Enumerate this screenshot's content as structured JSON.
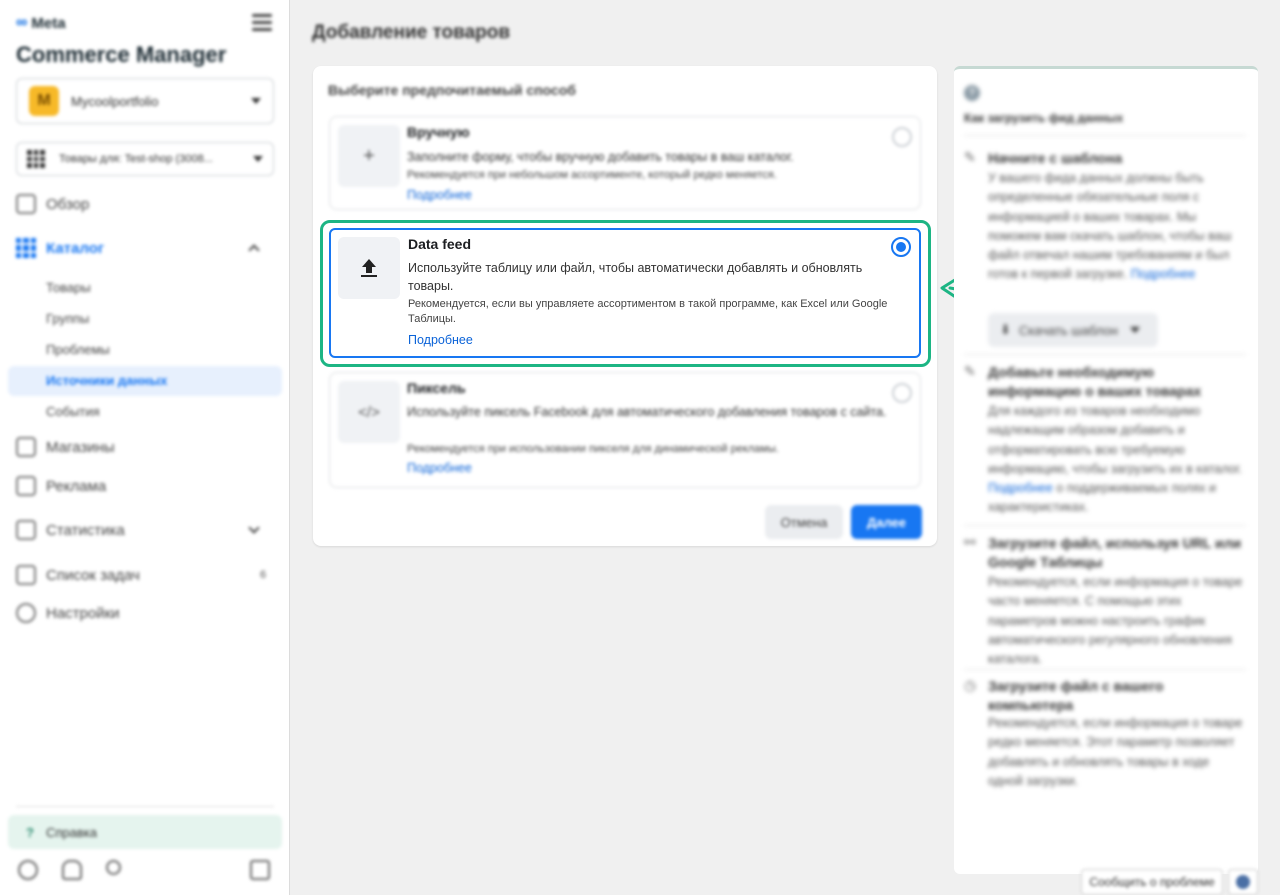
{
  "brand": {
    "logo": "Meta",
    "app_title": "Commerce Manager"
  },
  "account": {
    "avatar_letter": "M",
    "name": "Mycoolportfolio"
  },
  "catalog_select": {
    "label": "Товары для: Test-shop (3008..."
  },
  "nav": {
    "overview": "Обзор",
    "catalog": "Каталог",
    "catalog_sub": [
      "Товары",
      "Группы",
      "Проблемы",
      "Источники данных",
      "События"
    ],
    "shops": "Магазины",
    "ads": "Реклама",
    "stats": "Статистика",
    "tasks": "Список задач",
    "tasks_badge": "6",
    "settings": "Настройки",
    "help": "Справка"
  },
  "main": {
    "page_title": "Добавление товаров",
    "card_heading": "Выберите предпочитаемый способ",
    "options": [
      {
        "title": "Вручную",
        "desc": "Заполните форму, чтобы вручную добавить товары в ваш каталог.",
        "note": "Рекомендуется при небольшом ассортименте, который редко меняется.",
        "link": "Подробнее",
        "icon": "+"
      },
      {
        "title": "Data feed",
        "desc": "Используйте таблицу или файл, чтобы автоматически добавлять и обновлять товары.",
        "note": "Рекомендуется, если вы управляете ассортиментом в такой программе, как Excel или Google Таблицы.",
        "link": "Подробнее"
      },
      {
        "title": "Пиксель",
        "desc": "Используйте пиксель Facebook для автоматического добавления товаров с сайта.",
        "note": "Рекомендуется при использовании пикселя для динамической рекламы.",
        "link": "Подробнее",
        "icon": "</>"
      }
    ],
    "cancel": "Отмена",
    "next": "Далее"
  },
  "right_panel": {
    "help_icon": "?",
    "heading": "Как загрузить фид данных",
    "sections": [
      {
        "title": "Начните с шаблона",
        "text": "У вашего фида данных должны быть определенные обязательные поля с информацией о ваших товарах. Мы поможем вам скачать шаблон, чтобы ваш файл отвечал нашим требованиям и был готов к первой загрузке.",
        "link": "Подробнее",
        "button": "Скачать шаблон"
      },
      {
        "title": "Добавьте необходимую информацию о ваших товарах",
        "text_before": "Для каждого из товаров необходимо надлежащим образом добавить и отформатировать всю требуемую информацию, чтобы загрузить их в каталог.",
        "link": "Подробнее",
        "text_after": "о поддерживаемых полях и характеристиках."
      },
      {
        "title": "Загрузите файл, используя URL или Google Таблицы",
        "text": "Рекомендуется, если информация о товаре часто меняется. С помощью этих параметров можно настроить график автоматического регулярного обновления каталога."
      },
      {
        "title": "Загрузите файл с вашего компьютера",
        "text": "Рекомендуется, если информация о товаре редко меняется. Этот параметр позволяет добавлять и обновлять товары в ходе одной загрузки."
      }
    ]
  },
  "footer": {
    "report": "Сообщить о проблеме"
  },
  "colors": {
    "accent": "#1877f2",
    "highlight": "#1db584"
  }
}
